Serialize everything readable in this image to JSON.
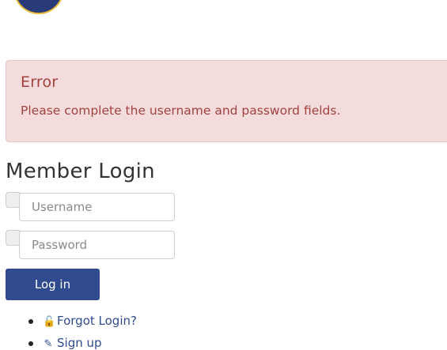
{
  "alert": {
    "title": "Error",
    "message": "Please complete the username and password fields."
  },
  "login": {
    "heading": "Member Login",
    "username_placeholder": "Username",
    "password_placeholder": "Password",
    "submit_label": "Log in"
  },
  "links": [
    {
      "icon": "unlock-icon",
      "label": "Forgot Login?"
    },
    {
      "icon": "edit-icon",
      "label": "Sign up"
    }
  ],
  "colors": {
    "alert_bg": "#f4dcdd",
    "alert_text": "#a2423f",
    "primary": "#2f4a8f"
  }
}
